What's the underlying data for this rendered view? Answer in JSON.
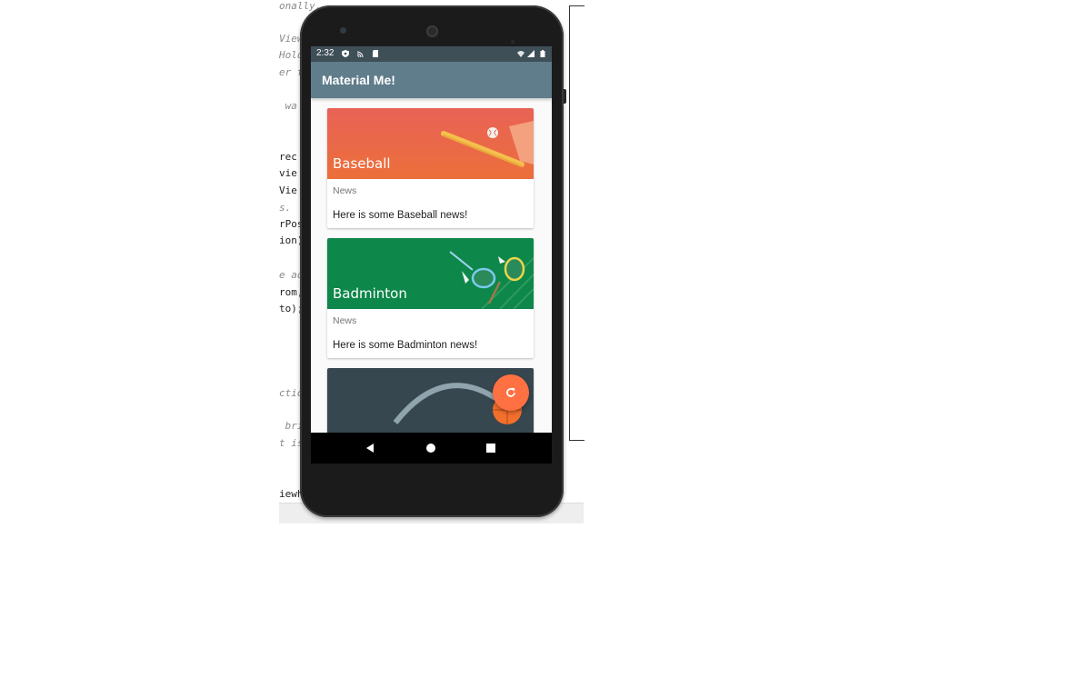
{
  "ide": {
    "code_lines": [
      {
        "text": "onally.",
        "comment": true
      },
      {
        "text": "View",
        "comment": true
      },
      {
        "text": "Hold",
        "comment": true
      },
      {
        "text": "er t",
        "comment": true
      },
      {
        "text": " wa",
        "comment": true
      },
      {
        "text": "rec",
        "comment": false
      },
      {
        "text": "vie",
        "comment": false
      },
      {
        "text": "Vie",
        "comment": false
      },
      {
        "text": "s.",
        "comment": true
      },
      {
        "text": "rPos",
        "comment": false
      },
      {
        "text": "ion);",
        "comment": false
      },
      {
        "text": "e ad",
        "comment": true
      },
      {
        "text": "rom,",
        "comment": false
      },
      {
        "text": "to);",
        "comment": false
      },
      {
        "text": "ctio",
        "comment": true
      },
      {
        "text": " bri",
        "comment": true
      },
      {
        "text": "t is",
        "comment": true
      },
      {
        "text": "iewh",
        "comment": false
      }
    ]
  },
  "status_bar": {
    "time": "2:32",
    "icons": [
      "shield-icon",
      "cast-icon",
      "sd-card-icon",
      "wifi-icon",
      "signal-icon",
      "battery-icon"
    ]
  },
  "app_bar": {
    "title": "Material Me!",
    "color": "#607d8b"
  },
  "cards": [
    {
      "title": "Baseball",
      "subtitle": "News",
      "info": "Here is some Baseball news!",
      "color_top": "#e96257",
      "color_bottom": "#ec6f3a"
    },
    {
      "title": "Badminton",
      "subtitle": "News",
      "info": "Here is some Badminton news!",
      "color_top": "#0b8a4a",
      "color_bottom": "#107a42"
    },
    {
      "title": "",
      "subtitle": "",
      "info": "",
      "color_top": "#37474f",
      "color_bottom": "#37474f"
    }
  ],
  "fab": {
    "icon": "refresh-icon",
    "color": "#ff7043"
  },
  "nav_bar": {
    "buttons": [
      "back-icon",
      "home-icon",
      "recents-icon"
    ]
  }
}
